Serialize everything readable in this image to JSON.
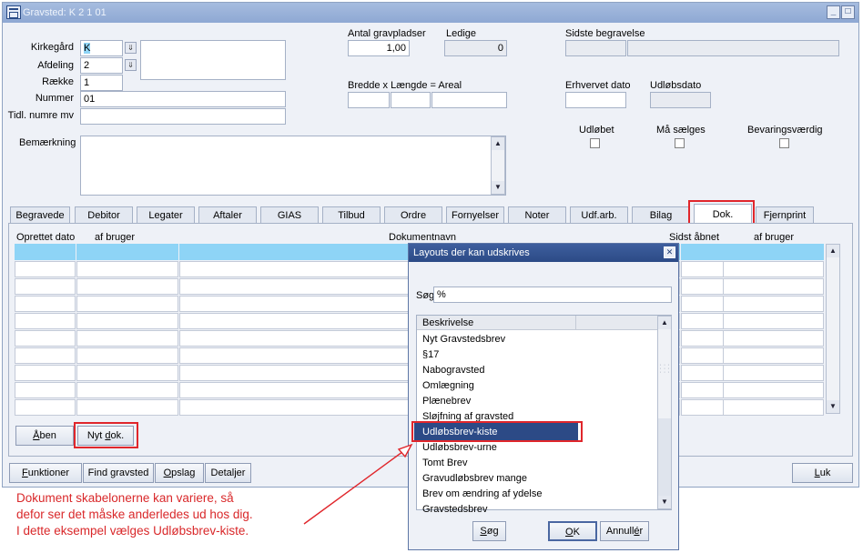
{
  "window": {
    "title": "Gravsted: K  2  1  01"
  },
  "header": {
    "kirkegaard_label": "Kirkegård",
    "kirkegaard_value": "K",
    "afdeling_label": "Afdeling",
    "afdeling_value": "2",
    "raekke_label": "Række",
    "raekke_value": "1",
    "nummer_label": "Nummer",
    "nummer_value": "01",
    "tidl_label": "Tidl. numre mv",
    "tidl_value": "",
    "bemaerkning_label": "Bemærkning",
    "antal_label": "Antal gravpladser",
    "antal_value": "1,00",
    "ledige_label": "Ledige",
    "ledige_value": "0",
    "sidste_label": "Sidste begravelse",
    "bredde_label": "Bredde x Længde = Areal",
    "erhvervet_label": "Erhvervet dato",
    "udloebsdato_label": "Udløbsdato",
    "udloebet_label": "Udløbet",
    "maa_saelges_label": "Må sælges",
    "bevaring_label": "Bevaringsværdig"
  },
  "tabs": [
    "Begravede",
    "Debitor",
    "Legater",
    "Aftaler",
    "GIAS",
    "Tilbud",
    "Ordre",
    "Fornyelser",
    "Noter",
    "Udf.arb.",
    "Bilag",
    "Dok.",
    "Fjernprint"
  ],
  "grid": {
    "col_oprettet": "Oprettet dato",
    "col_af_bruger": "af bruger",
    "col_dokumentnavn": "Dokumentnavn",
    "col_sidst_aabnet": "Sidst åbnet",
    "col_af_bruger2": "af bruger"
  },
  "buttons": {
    "aaben_key": "Å",
    "aaben_rest": "ben",
    "nyt_pre": "Nyt ",
    "nyt_key": "d",
    "nyt_rest": "ok.",
    "funktioner_key": "F",
    "funktioner_rest": "unktioner",
    "find_gravsted": "Find gravsted",
    "opslag_key": "O",
    "opslag_rest": "pslag",
    "detaljer": "Detaljer",
    "luk_key": "L",
    "luk_rest": "uk"
  },
  "dialog": {
    "title": "Layouts der kan udskrives",
    "search_label": "Søg",
    "search_value": "%",
    "column_header": "Beskrivelse",
    "items": [
      "Nyt Gravstedsbrev",
      "§17",
      "Nabogravsted",
      "Omlægning",
      "Plænebrev",
      "Sløjfning af gravsted",
      "Udløbsbrev-kiste",
      "Udløbsbrev-urne",
      "Tomt Brev",
      "Gravudløbsbrev mange",
      "Brev om ændring af ydelse",
      "Gravstedsbrev"
    ],
    "sog_key": "S",
    "sog_rest": "øg",
    "ok_key": "O",
    "ok_rest": "K",
    "annuller_pre": "Annull",
    "annuller_key": "é",
    "annuller_rest": "r"
  },
  "annotation": {
    "line1": "Dokument skabelonerne kan variere, så",
    "line2": "defor ser det måske anderledes ud hos dig.",
    "line3": "I dette eksempel vælges Udløbsbrev-kiste."
  },
  "colors": {
    "selection": "#8ed4f6",
    "highlight": "#e0262b",
    "dialog_selection": "#2c4a86"
  }
}
